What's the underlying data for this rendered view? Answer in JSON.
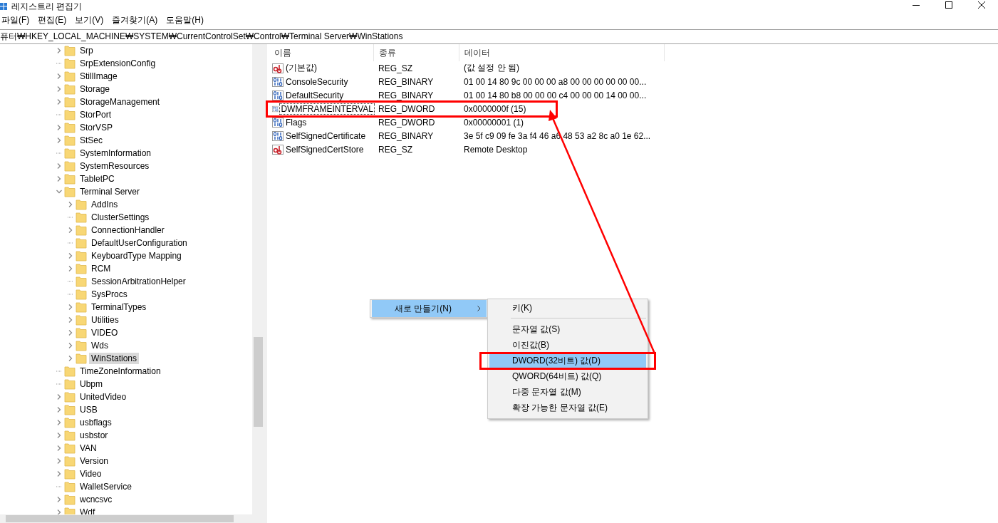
{
  "window": {
    "title": "레지스트리 편집기"
  },
  "menu_bar": [
    {
      "label": "파일(F)"
    },
    {
      "label": "편집(E)"
    },
    {
      "label": "보기(V)"
    },
    {
      "label": "즐겨찾기(A)"
    },
    {
      "label": "도움말(H)"
    }
  ],
  "address": "퓨터₩HKEY_LOCAL_MACHINE₩SYSTEM₩CurrentControlSet₩Control₩Terminal Server₩WinStations",
  "tree": [
    {
      "label": "Srp",
      "expandable": true,
      "expanded": false,
      "selected": false
    },
    {
      "label": "SrpExtensionConfig",
      "expandable": false,
      "selected": false
    },
    {
      "label": "StillImage",
      "expandable": true,
      "expanded": false,
      "selected": false
    },
    {
      "label": "Storage",
      "expandable": true,
      "expanded": false,
      "selected": false
    },
    {
      "label": "StorageManagement",
      "expandable": true,
      "expanded": false,
      "selected": false
    },
    {
      "label": "StorPort",
      "expandable": false,
      "selected": false
    },
    {
      "label": "StorVSP",
      "expandable": true,
      "expanded": false,
      "selected": false
    },
    {
      "label": "StSec",
      "expandable": true,
      "expanded": false,
      "selected": false
    },
    {
      "label": "SystemInformation",
      "expandable": false,
      "selected": false
    },
    {
      "label": "SystemResources",
      "expandable": true,
      "expanded": false,
      "selected": false
    },
    {
      "label": "TabletPC",
      "expandable": true,
      "expanded": false,
      "selected": false
    },
    {
      "label": "Terminal Server",
      "expandable": true,
      "expanded": true,
      "selected": false,
      "children": [
        {
          "label": "AddIns",
          "expandable": true,
          "expanded": false,
          "selected": false
        },
        {
          "label": "ClusterSettings",
          "expandable": false,
          "selected": false
        },
        {
          "label": "ConnectionHandler",
          "expandable": true,
          "expanded": false,
          "selected": false
        },
        {
          "label": "DefaultUserConfiguration",
          "expandable": false,
          "selected": false
        },
        {
          "label": "KeyboardType Mapping",
          "expandable": true,
          "expanded": false,
          "selected": false
        },
        {
          "label": "RCM",
          "expandable": true,
          "expanded": false,
          "selected": false
        },
        {
          "label": "SessionArbitrationHelper",
          "expandable": false,
          "selected": false
        },
        {
          "label": "SysProcs",
          "expandable": false,
          "selected": false
        },
        {
          "label": "TerminalTypes",
          "expandable": true,
          "expanded": false,
          "selected": false
        },
        {
          "label": "Utilities",
          "expandable": true,
          "expanded": false,
          "selected": false
        },
        {
          "label": "VIDEO",
          "expandable": true,
          "expanded": false,
          "selected": false
        },
        {
          "label": "Wds",
          "expandable": true,
          "expanded": false,
          "selected": false
        },
        {
          "label": "WinStations",
          "expandable": true,
          "expanded": false,
          "selected": true
        }
      ]
    },
    {
      "label": "TimeZoneInformation",
      "expandable": false,
      "selected": false
    },
    {
      "label": "Ubpm",
      "expandable": false,
      "selected": false
    },
    {
      "label": "UnitedVideo",
      "expandable": true,
      "expanded": false,
      "selected": false
    },
    {
      "label": "USB",
      "expandable": true,
      "expanded": false,
      "selected": false
    },
    {
      "label": "usbflags",
      "expandable": true,
      "expanded": false,
      "selected": false
    },
    {
      "label": "usbstor",
      "expandable": true,
      "expanded": false,
      "selected": false
    },
    {
      "label": "VAN",
      "expandable": true,
      "expanded": false,
      "selected": false
    },
    {
      "label": "Version",
      "expandable": true,
      "expanded": false,
      "selected": false
    },
    {
      "label": "Video",
      "expandable": true,
      "expanded": false,
      "selected": false
    },
    {
      "label": "WalletService",
      "expandable": false,
      "selected": false
    },
    {
      "label": "wcncsvc",
      "expandable": true,
      "expanded": false,
      "selected": false
    },
    {
      "label": "Wdf",
      "expandable": true,
      "expanded": false,
      "selected": false
    }
  ],
  "table": {
    "columns": [
      "이름",
      "종류",
      "데이터"
    ],
    "rows": [
      {
        "kind": "string",
        "name": "(기본값)",
        "type": "REG_SZ",
        "data": "(값 설정 안 됨)",
        "focused": false
      },
      {
        "kind": "binary",
        "name": "ConsoleSecurity",
        "type": "REG_BINARY",
        "data": "01 00 14 80 9c 00 00 00 a8 00 00 00 00 00 00...",
        "focused": false
      },
      {
        "kind": "binary",
        "name": "DefaultSecurity",
        "type": "REG_BINARY",
        "data": "01 00 14 80 b8 00 00 00 c4 00 00 00 14 00 00...",
        "focused": false
      },
      {
        "kind": "binary",
        "name": "DWMFRAMEINTERVAL",
        "type": "REG_DWORD",
        "data": "0x0000000f (15)",
        "focused": true
      },
      {
        "kind": "binary",
        "name": "Flags",
        "type": "REG_DWORD",
        "data": "0x00000001 (1)",
        "focused": false
      },
      {
        "kind": "binary",
        "name": "SelfSignedCertificate",
        "type": "REG_BINARY",
        "data": "3e 5f c9 09 fe 3a f4 46 a6 48 53 a2 8c a0 1e 62...",
        "focused": false
      },
      {
        "kind": "string",
        "name": "SelfSignedCertStore",
        "type": "REG_SZ",
        "data": "Remote Desktop",
        "focused": false
      }
    ]
  },
  "context_menu": {
    "items": [
      {
        "label": "새로 만들기(N)",
        "selected": true
      }
    ]
  },
  "submenu": {
    "items": [
      {
        "kind": "item",
        "label": "키(K)",
        "selected": false
      },
      {
        "kind": "separator"
      },
      {
        "kind": "item",
        "label": "문자열 값(S)",
        "selected": false
      },
      {
        "kind": "item",
        "label": "이진값(B)",
        "selected": false
      },
      {
        "kind": "item",
        "label": "DWORD(32비트) 값(D)",
        "selected": true
      },
      {
        "kind": "item",
        "label": "QWORD(64비트) 값(Q)",
        "selected": false
      },
      {
        "kind": "item",
        "label": "다중 문자열 값(M)",
        "selected": false
      },
      {
        "kind": "item",
        "label": "확장 가능한 문자열 값(E)",
        "selected": false
      }
    ]
  }
}
